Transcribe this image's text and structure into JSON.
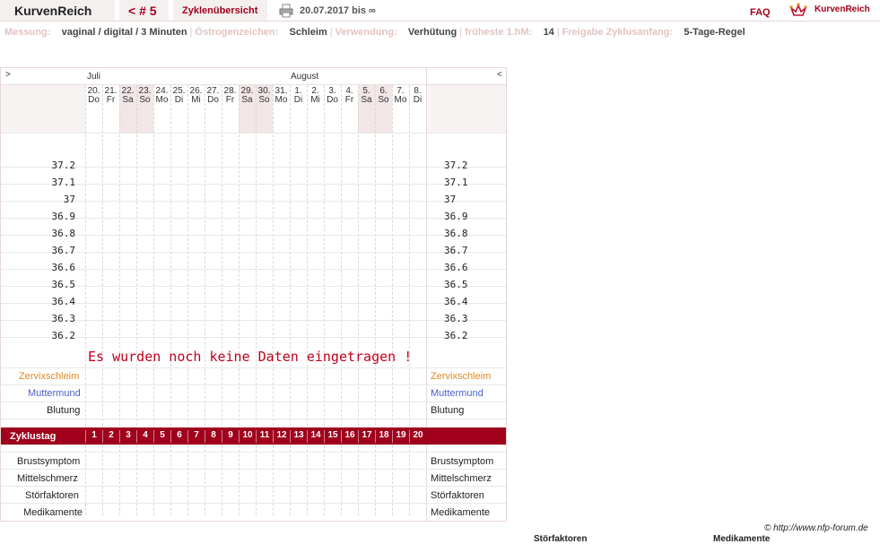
{
  "topbar": {
    "app_title": "KurvenReich",
    "cycle_label": "< # 5",
    "overview_label": "Zyklenübersicht",
    "date_range": "20.07.2017 bis ∞",
    "faq_label": "FAQ",
    "logo_text": "KurvenReich"
  },
  "info": {
    "measurement_label": "Messung:",
    "measurement_value": "vaginal / digital / 3 Minuten",
    "estrogen_label": "Östrogenzeichen:",
    "estrogen_value": "Schleim",
    "usage_label": "Verwendung:",
    "usage_value": "Verhütung",
    "earliest_label": "früheste 1.hM:",
    "earliest_value": "14",
    "release_label": "Freigabe Zyklusanfang:",
    "release_value": "5-Tage-Regel"
  },
  "chart": {
    "nav_prev": ">",
    "nav_next": "<",
    "months": [
      "Juli",
      "August"
    ],
    "days": [
      {
        "num": "20.",
        "wd": "Do"
      },
      {
        "num": "21.",
        "wd": "Fr"
      },
      {
        "num": "22.",
        "wd": "Sa"
      },
      {
        "num": "23.",
        "wd": "So"
      },
      {
        "num": "24.",
        "wd": "Mo"
      },
      {
        "num": "25.",
        "wd": "Di"
      },
      {
        "num": "26.",
        "wd": "Mi"
      },
      {
        "num": "27.",
        "wd": "Do"
      },
      {
        "num": "28.",
        "wd": "Fr"
      },
      {
        "num": "29.",
        "wd": "Sa"
      },
      {
        "num": "30.",
        "wd": "So"
      },
      {
        "num": "31.",
        "wd": "Mo"
      },
      {
        "num": "1.",
        "wd": "Di"
      },
      {
        "num": "2.",
        "wd": "Mi"
      },
      {
        "num": "3.",
        "wd": "Do"
      },
      {
        "num": "4.",
        "wd": "Fr"
      },
      {
        "num": "5.",
        "wd": "Sa"
      },
      {
        "num": "6.",
        "wd": "So"
      },
      {
        "num": "7.",
        "wd": "Mo"
      },
      {
        "num": "8.",
        "wd": "Di"
      }
    ],
    "temps": [
      "37.2",
      "37.1",
      "37",
      "36.9",
      "36.8",
      "36.7",
      "36.6",
      "36.5",
      "36.4",
      "36.3",
      "36.2"
    ],
    "no_data_message": "Es wurden noch keine Daten eingetragen !",
    "zervix_label": "Zervixschleim",
    "muttermund_label": "Muttermund",
    "blutung_label": "Blutung",
    "zyklustag_label": "Zyklustag",
    "cycle_days": [
      "1",
      "2",
      "3",
      "4",
      "5",
      "6",
      "7",
      "8",
      "9",
      "10",
      "11",
      "12",
      "13",
      "14",
      "15",
      "16",
      "17",
      "18",
      "19",
      "20"
    ],
    "brust_label": "Brustsymptom",
    "mittel_label": "Mittelschmerz",
    "stoer_label": "Störfaktoren",
    "medi_label": "Medikamente"
  },
  "footer": {
    "copyright": "© http://www.nfp-forum.de",
    "stoer_heading": "Störfaktoren",
    "medi_heading": "Medikamente"
  },
  "colors": {
    "accent": "#a0001c",
    "zervix": "#e08a1e",
    "muttermund": "#4a5fc8",
    "weekend": "#f2e6e6"
  }
}
